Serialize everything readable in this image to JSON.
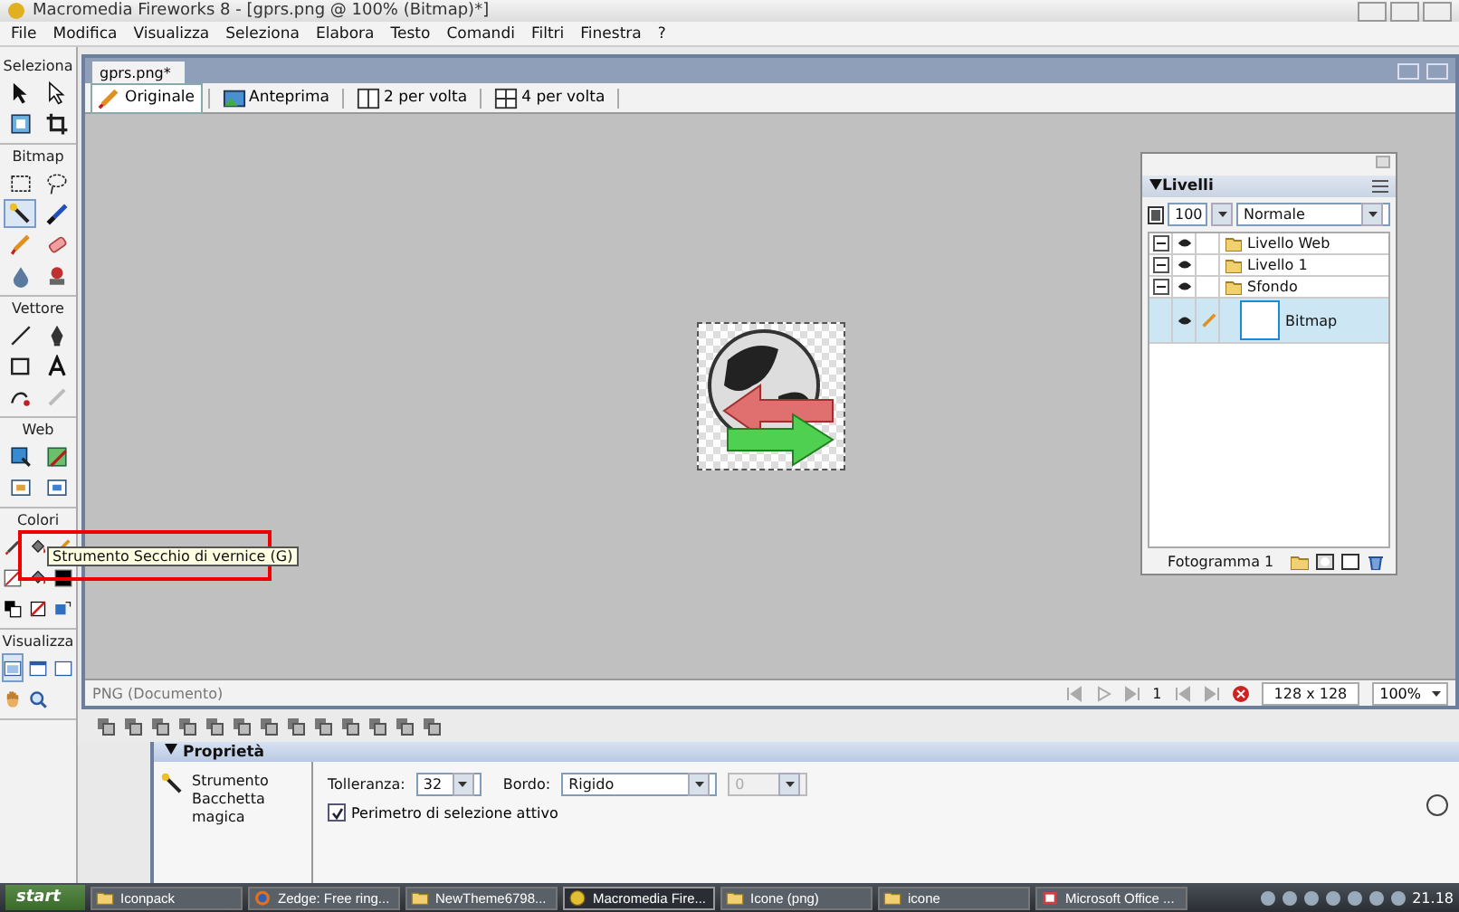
{
  "window": {
    "title": "Macromedia Fireworks 8 - [gprs.png @ 100% (Bitmap)*]"
  },
  "menu": [
    "File",
    "Modifica",
    "Visualizza",
    "Seleziona",
    "Elabora",
    "Testo",
    "Comandi",
    "Filtri",
    "Finestra",
    "?"
  ],
  "toolbox": [
    {
      "title": "Seleziona",
      "tools": [
        {
          "kind": "pointer",
          "selected": false
        },
        {
          "kind": "subselect",
          "selected": false
        },
        {
          "kind": "scale",
          "selected": false
        },
        {
          "kind": "crop",
          "selected": false
        }
      ]
    },
    {
      "title": "Bitmap",
      "tools": [
        {
          "kind": "marquee",
          "selected": false
        },
        {
          "kind": "lasso",
          "selected": false
        },
        {
          "kind": "wand",
          "selected": true
        },
        {
          "kind": "brush",
          "selected": false
        },
        {
          "kind": "pencil",
          "selected": false
        },
        {
          "kind": "eraser",
          "selected": false
        },
        {
          "kind": "drop",
          "selected": false
        },
        {
          "kind": "stamp",
          "selected": false
        }
      ]
    },
    {
      "title": "Vettore",
      "tools": [
        {
          "kind": "line",
          "selected": false
        },
        {
          "kind": "pen",
          "selected": false
        },
        {
          "kind": "rect",
          "selected": false
        },
        {
          "kind": "text",
          "selected": false
        },
        {
          "kind": "knife",
          "selected": false
        },
        {
          "kind": "freeform",
          "selected": false
        }
      ]
    },
    {
      "title": "Web",
      "tools": [
        {
          "kind": "hotspot",
          "selected": false
        },
        {
          "kind": "slice",
          "selected": false
        },
        {
          "kind": "hide",
          "selected": false
        },
        {
          "kind": "show",
          "selected": false
        }
      ]
    },
    {
      "title": "Colori",
      "tools": [
        {
          "kind": "eyedropper",
          "selected": false
        },
        {
          "kind": "bucket",
          "selected": false
        },
        {
          "kind": "pencil",
          "selected": false
        },
        {
          "kind": "stroke-swatch",
          "selected": false
        },
        {
          "kind": "bucket",
          "selected": false
        },
        {
          "kind": "fill-swatch",
          "selected": false
        },
        {
          "kind": "default-colors",
          "selected": false
        },
        {
          "kind": "none-color",
          "selected": false
        },
        {
          "kind": "swap-colors",
          "selected": false
        }
      ]
    },
    {
      "title": "Visualizza",
      "tools": [
        {
          "kind": "standard-mode",
          "selected": true
        },
        {
          "kind": "full-menu-mode",
          "selected": false
        },
        {
          "kind": "full-mode",
          "selected": false
        },
        {
          "kind": "hand",
          "selected": false
        },
        {
          "kind": "zoom",
          "selected": false
        }
      ]
    }
  ],
  "tooltip": "Strumento Secchio di vernice (G)",
  "document": {
    "tab": "gprs.png*",
    "views": [
      {
        "label": "Originale",
        "kind": "pencil",
        "selected": true
      },
      {
        "label": "Anteprima",
        "kind": "preview",
        "selected": false
      },
      {
        "label": "2 per volta",
        "kind": "two-up",
        "selected": false
      },
      {
        "label": "4 per volta",
        "kind": "four-up",
        "selected": false
      }
    ],
    "status": {
      "file_type": "PNG (Documento)",
      "frame": "1",
      "size": "128 x 128",
      "zoom": "100%"
    }
  },
  "layers_panel": {
    "title": "Livelli",
    "opacity": "100",
    "blend": "Normale",
    "layers": [
      {
        "name": "Livello Web",
        "selected": false
      },
      {
        "name": "Livello 1",
        "selected": false
      },
      {
        "name": "Sfondo",
        "selected": false,
        "children": [
          {
            "name": "Bitmap",
            "selected": true
          }
        ]
      }
    ],
    "frame": "Fotogramma 1"
  },
  "properties": {
    "title": "Proprietà",
    "tool_name": "Strumento Bacchetta magica",
    "tolerance_label": "Tolleranza:",
    "tolerance": "32",
    "edge_label": "Bordo:",
    "edge": "Rigido",
    "feather": "0",
    "feather_disabled": true,
    "checkbox": {
      "label": "Perimetro di selezione attivo",
      "checked": true
    }
  },
  "taskbar": {
    "start": "start",
    "items": [
      {
        "label": "Iconpack",
        "kind": "folder",
        "selected": false
      },
      {
        "label": "Zedge: Free ring...",
        "kind": "browser",
        "selected": false
      },
      {
        "label": "NewTheme6798...",
        "kind": "folder",
        "selected": false
      },
      {
        "label": "Macromedia Fire...",
        "kind": "app",
        "selected": true
      },
      {
        "label": "Icone (png)",
        "kind": "folder",
        "selected": false
      },
      {
        "label": "icone",
        "kind": "folder",
        "selected": false
      },
      {
        "label": "Microsoft Office ...",
        "kind": "office",
        "selected": false
      }
    ],
    "clock": "21.18"
  }
}
